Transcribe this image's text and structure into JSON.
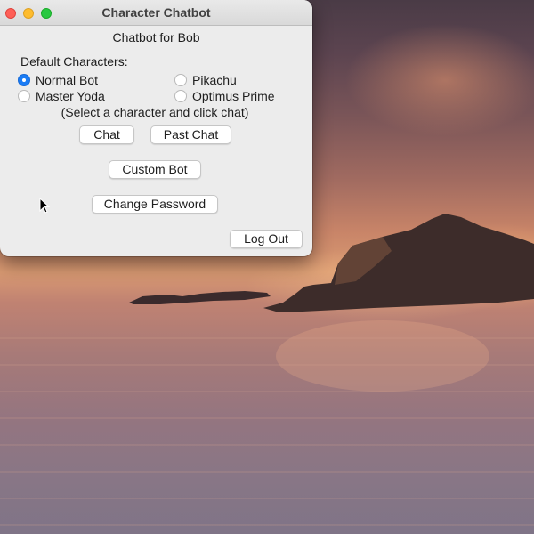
{
  "window": {
    "title": "Character Chatbot",
    "heading": "Chatbot for Bob",
    "traffic_lights": {
      "close": "#fe5f57",
      "minimize": "#febc2e",
      "maximize": "#28c840"
    }
  },
  "characters": {
    "group_label": "Default Characters:",
    "options": [
      {
        "label": "Normal Bot",
        "checked": true
      },
      {
        "label": "Pikachu",
        "checked": false
      },
      {
        "label": "Master Yoda",
        "checked": false
      },
      {
        "label": "Optimus Prime",
        "checked": false
      }
    ],
    "hint": "(Select a character and click chat)"
  },
  "buttons": {
    "chat": "Chat",
    "past_chat": "Past Chat",
    "custom_bot": "Custom Bot",
    "change_password": "Change Password",
    "log_out": "Log Out"
  },
  "colors": {
    "accent": "#1a7cf5"
  },
  "icons": {
    "cursor": "arrow-cursor-icon"
  }
}
